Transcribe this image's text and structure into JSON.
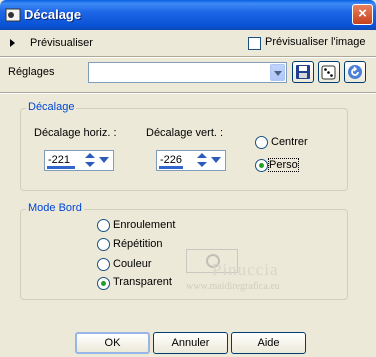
{
  "window": {
    "title": "Décalage",
    "close_label": "×"
  },
  "preview": {
    "label": "Prévisualiser",
    "image_checkbox_label": "Prévisualiser l'image",
    "image_checked": false
  },
  "settings": {
    "label": "Réglages",
    "value": ""
  },
  "offset_group": {
    "legend": "Décalage",
    "horizontal": {
      "label": "Décalage horiz. :",
      "value": "-221"
    },
    "vertical": {
      "label": "Décalage vert. :",
      "value": "-226"
    },
    "options": [
      {
        "label": "Centrer",
        "selected": false
      },
      {
        "label": "Perso",
        "selected": true
      }
    ]
  },
  "edge_mode_group": {
    "legend": "Mode Bord",
    "options": [
      {
        "label": "Enroulement",
        "selected": false
      },
      {
        "label": "Répétition",
        "selected": false
      },
      {
        "label": "Couleur",
        "selected": false
      },
      {
        "label": "Transparent",
        "selected": true
      }
    ]
  },
  "watermark": {
    "name": "Pinuccia",
    "url": "www.maidiregrafica.eu"
  },
  "buttons": {
    "ok": "OK",
    "cancel": "Annuler",
    "help": "Aide"
  },
  "colors": {
    "title_bar": "#0a53d6",
    "dialog_bg": "#ece9d8",
    "group_legend": "#0046d5",
    "radio_dot": "#21a121"
  }
}
